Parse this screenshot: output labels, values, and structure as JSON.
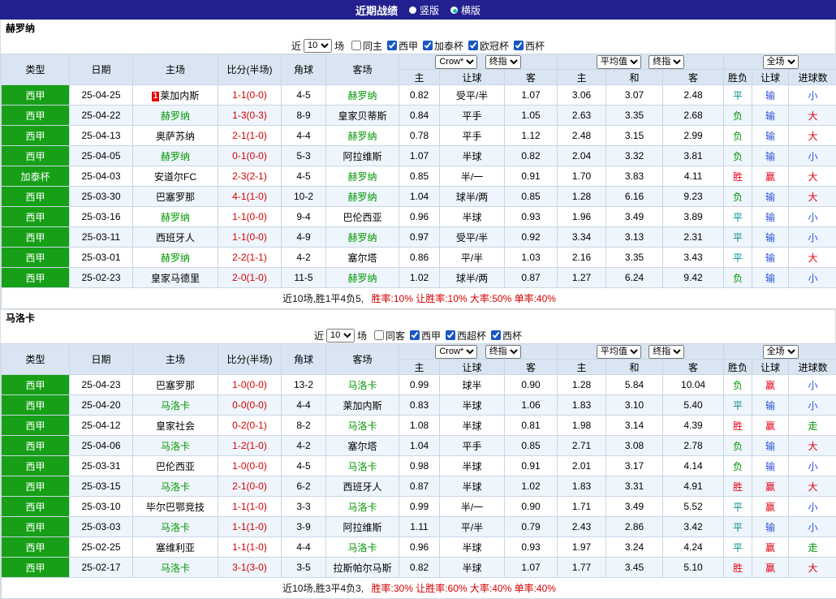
{
  "colors": {
    "topbar_bg": "#22218f",
    "header_bg": "#d9e5f2",
    "league_bg": "#17a017",
    "focus_team": "#009600",
    "score": "#d40000",
    "alt_row": "#eef5fc",
    "radio_dot": "#00cfa0"
  },
  "result_colors": {
    "胜": "#e60012",
    "平": "#008b8b",
    "负": "#009600",
    "赢": "#e60012",
    "输": "#2b51d8",
    "大": "#e60012",
    "小": "#2b51d8",
    "走": "#009600"
  },
  "top_bar": {
    "title": "近期战绩",
    "radios": [
      {
        "label": "竖版",
        "selected": false
      },
      {
        "label": "横版",
        "selected": true
      }
    ]
  },
  "table_headers": {
    "cols": [
      "类型",
      "日期",
      "主场",
      "比分(半场)",
      "角球",
      "客场"
    ],
    "group1_selects": [
      "Crow*",
      "终指"
    ],
    "group2_selects": [
      "平均值",
      "终指"
    ],
    "group3_select": "全场",
    "sub": [
      "主",
      "让球",
      "客",
      "主",
      "和",
      "客",
      "胜负",
      "让球",
      "进球数"
    ]
  },
  "sections": [
    {
      "team": "赫罗纳",
      "filter": {
        "prefix": "近",
        "count": "10",
        "suffix": "场",
        "checkboxes": [
          {
            "label": "同主",
            "checked": false
          },
          {
            "label": "西甲",
            "checked": true
          },
          {
            "label": "加泰杯",
            "checked": true
          },
          {
            "label": "欧冠杯",
            "checked": true
          },
          {
            "label": "西杯",
            "checked": true
          }
        ]
      },
      "rows": [
        {
          "league": "西甲",
          "date": "25-04-25",
          "home": "莱加内斯",
          "home_badge": "1",
          "home_focus": false,
          "score": "1-1(0-0)",
          "corner": "4-5",
          "away": "赫罗纳",
          "away_focus": true,
          "odds": [
            "0.82",
            "受平/半",
            "1.07"
          ],
          "avg": [
            "3.06",
            "3.07",
            "2.48"
          ],
          "outcome": "平",
          "handicap": "输",
          "goals": "小"
        },
        {
          "league": "西甲",
          "date": "25-04-22",
          "home": "赫罗纳",
          "home_focus": true,
          "score": "1-3(0-3)",
          "corner": "8-9",
          "away": "皇家贝蒂斯",
          "away_focus": false,
          "odds": [
            "0.84",
            "平手",
            "1.05"
          ],
          "avg": [
            "2.63",
            "3.35",
            "2.68"
          ],
          "outcome": "负",
          "handicap": "输",
          "goals": "大"
        },
        {
          "league": "西甲",
          "date": "25-04-13",
          "home": "奥萨苏纳",
          "home_focus": false,
          "score": "2-1(1-0)",
          "corner": "4-4",
          "away": "赫罗纳",
          "away_focus": true,
          "odds": [
            "0.78",
            "平手",
            "1.12"
          ],
          "avg": [
            "2.48",
            "3.15",
            "2.99"
          ],
          "outcome": "负",
          "handicap": "输",
          "goals": "大"
        },
        {
          "league": "西甲",
          "date": "25-04-05",
          "home": "赫罗纳",
          "home_focus": true,
          "score": "0-1(0-0)",
          "corner": "5-3",
          "away": "阿拉维斯",
          "away_focus": false,
          "odds": [
            "1.07",
            "半球",
            "0.82"
          ],
          "avg": [
            "2.04",
            "3.32",
            "3.81"
          ],
          "outcome": "负",
          "handicap": "输",
          "goals": "小"
        },
        {
          "league": "加泰杯",
          "date": "25-04-03",
          "home": "安道尔FC",
          "home_focus": false,
          "score": "2-3(2-1)",
          "corner": "4-5",
          "away": "赫罗纳",
          "away_focus": true,
          "odds": [
            "0.85",
            "半/一",
            "0.91"
          ],
          "avg": [
            "1.70",
            "3.83",
            "4.11"
          ],
          "outcome": "胜",
          "handicap": "赢",
          "goals": "大"
        },
        {
          "league": "西甲",
          "date": "25-03-30",
          "home": "巴塞罗那",
          "home_focus": false,
          "score": "4-1(1-0)",
          "corner": "10-2",
          "away": "赫罗纳",
          "away_focus": true,
          "odds": [
            "1.04",
            "球半/两",
            "0.85"
          ],
          "avg": [
            "1.28",
            "6.16",
            "9.23"
          ],
          "outcome": "负",
          "handicap": "输",
          "goals": "大"
        },
        {
          "league": "西甲",
          "date": "25-03-16",
          "home": "赫罗纳",
          "home_focus": true,
          "score": "1-1(0-0)",
          "corner": "9-4",
          "away": "巴伦西亚",
          "away_focus": false,
          "odds": [
            "0.96",
            "半球",
            "0.93"
          ],
          "avg": [
            "1.96",
            "3.49",
            "3.89"
          ],
          "outcome": "平",
          "handicap": "输",
          "goals": "小"
        },
        {
          "league": "西甲",
          "date": "25-03-11",
          "home": "西班牙人",
          "home_focus": false,
          "score": "1-1(0-0)",
          "corner": "4-9",
          "away": "赫罗纳",
          "away_focus": true,
          "odds": [
            "0.97",
            "受平/半",
            "0.92"
          ],
          "avg": [
            "3.34",
            "3.13",
            "2.31"
          ],
          "outcome": "平",
          "handicap": "输",
          "goals": "小"
        },
        {
          "league": "西甲",
          "date": "25-03-01",
          "home": "赫罗纳",
          "home_focus": true,
          "score": "2-2(1-1)",
          "corner": "4-2",
          "away": "塞尔塔",
          "away_focus": false,
          "odds": [
            "0.86",
            "平/半",
            "1.03"
          ],
          "avg": [
            "2.16",
            "3.35",
            "3.43"
          ],
          "outcome": "平",
          "handicap": "输",
          "goals": "大"
        },
        {
          "league": "西甲",
          "date": "25-02-23",
          "home": "皇家马德里",
          "home_focus": false,
          "score": "2-0(1-0)",
          "corner": "11-5",
          "away": "赫罗纳",
          "away_focus": true,
          "odds": [
            "1.02",
            "球半/两",
            "0.87"
          ],
          "avg": [
            "1.27",
            "6.24",
            "9.42"
          ],
          "outcome": "负",
          "handicap": "输",
          "goals": "小"
        }
      ],
      "summary_prefix": "近10场,胜1平4负5,",
      "summary_stats": "胜率:10% 让胜率:10% 大率:50% 单率:40%"
    },
    {
      "team": "马洛卡",
      "filter": {
        "prefix": "近",
        "count": "10",
        "suffix": "场",
        "checkboxes": [
          {
            "label": "同客",
            "checked": false
          },
          {
            "label": "西甲",
            "checked": true
          },
          {
            "label": "西超杯",
            "checked": true
          },
          {
            "label": "西杯",
            "checked": true
          }
        ]
      },
      "rows": [
        {
          "league": "西甲",
          "date": "25-04-23",
          "home": "巴塞罗那",
          "home_focus": false,
          "score": "1-0(0-0)",
          "corner": "13-2",
          "away": "马洛卡",
          "away_focus": true,
          "odds": [
            "0.99",
            "球半",
            "0.90"
          ],
          "avg": [
            "1.28",
            "5.84",
            "10.04"
          ],
          "outcome": "负",
          "handicap": "赢",
          "goals": "小"
        },
        {
          "league": "西甲",
          "date": "25-04-20",
          "home": "马洛卡",
          "home_focus": true,
          "score": "0-0(0-0)",
          "corner": "4-4",
          "away": "莱加内斯",
          "away_focus": false,
          "odds": [
            "0.83",
            "半球",
            "1.06"
          ],
          "avg": [
            "1.83",
            "3.10",
            "5.40"
          ],
          "outcome": "平",
          "handicap": "输",
          "goals": "小"
        },
        {
          "league": "西甲",
          "date": "25-04-12",
          "home": "皇家社会",
          "home_focus": false,
          "score": "0-2(0-1)",
          "corner": "8-2",
          "away": "马洛卡",
          "away_focus": true,
          "odds": [
            "1.08",
            "半球",
            "0.81"
          ],
          "avg": [
            "1.98",
            "3.14",
            "4.39"
          ],
          "outcome": "胜",
          "handicap": "赢",
          "goals": "走"
        },
        {
          "league": "西甲",
          "date": "25-04-06",
          "home": "马洛卡",
          "home_focus": true,
          "score": "1-2(1-0)",
          "corner": "4-2",
          "away": "塞尔塔",
          "away_focus": false,
          "odds": [
            "1.04",
            "平手",
            "0.85"
          ],
          "avg": [
            "2.71",
            "3.08",
            "2.78"
          ],
          "outcome": "负",
          "handicap": "输",
          "goals": "大"
        },
        {
          "league": "西甲",
          "date": "25-03-31",
          "home": "巴伦西亚",
          "home_focus": false,
          "score": "1-0(0-0)",
          "corner": "4-5",
          "away": "马洛卡",
          "away_focus": true,
          "odds": [
            "0.98",
            "半球",
            "0.91"
          ],
          "avg": [
            "2.01",
            "3.17",
            "4.14"
          ],
          "outcome": "负",
          "handicap": "输",
          "goals": "小"
        },
        {
          "league": "西甲",
          "date": "25-03-15",
          "home": "马洛卡",
          "home_focus": true,
          "score": "2-1(0-0)",
          "corner": "6-2",
          "away": "西班牙人",
          "away_focus": false,
          "odds": [
            "0.87",
            "半球",
            "1.02"
          ],
          "avg": [
            "1.83",
            "3.31",
            "4.91"
          ],
          "outcome": "胜",
          "handicap": "赢",
          "goals": "大"
        },
        {
          "league": "西甲",
          "date": "25-03-10",
          "home": "毕尔巴鄂竞技",
          "home_focus": false,
          "score": "1-1(1-0)",
          "corner": "3-3",
          "away": "马洛卡",
          "away_focus": true,
          "odds": [
            "0.99",
            "半/一",
            "0.90"
          ],
          "avg": [
            "1.71",
            "3.49",
            "5.52"
          ],
          "outcome": "平",
          "handicap": "赢",
          "goals": "小"
        },
        {
          "league": "西甲",
          "date": "25-03-03",
          "home": "马洛卡",
          "home_focus": true,
          "score": "1-1(1-0)",
          "corner": "3-9",
          "away": "阿拉维斯",
          "away_focus": false,
          "odds": [
            "1.11",
            "平/半",
            "0.79"
          ],
          "avg": [
            "2.43",
            "2.86",
            "3.42"
          ],
          "outcome": "平",
          "handicap": "输",
          "goals": "小"
        },
        {
          "league": "西甲",
          "date": "25-02-25",
          "home": "塞维利亚",
          "home_focus": false,
          "score": "1-1(1-0)",
          "corner": "4-4",
          "away": "马洛卡",
          "away_focus": true,
          "odds": [
            "0.96",
            "半球",
            "0.93"
          ],
          "avg": [
            "1.97",
            "3.24",
            "4.24"
          ],
          "outcome": "平",
          "handicap": "赢",
          "goals": "走"
        },
        {
          "league": "西甲",
          "date": "25-02-17",
          "home": "马洛卡",
          "home_focus": true,
          "score": "3-1(3-0)",
          "corner": "3-5",
          "away": "拉斯帕尔马斯",
          "away_focus": false,
          "odds": [
            "0.82",
            "半球",
            "1.07"
          ],
          "avg": [
            "1.77",
            "3.45",
            "5.10"
          ],
          "outcome": "胜",
          "handicap": "赢",
          "goals": "大"
        }
      ],
      "summary_prefix": "近10场,胜3平4负3,",
      "summary_stats": "胜率:30% 让胜率:60% 大率:40% 单率:40%"
    }
  ]
}
